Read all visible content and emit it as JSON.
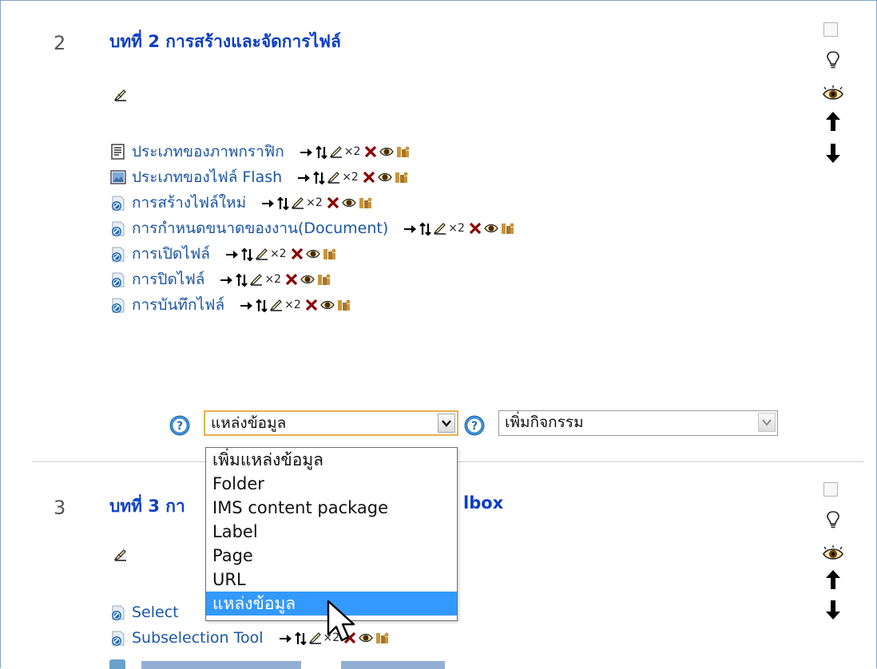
{
  "sections": [
    {
      "number": "2",
      "title": "บทที่ 2 การสร้างและจัดการไฟล์",
      "activities": [
        {
          "icon": "document-icon",
          "label": "ประเภทของภาพกราฟิก"
        },
        {
          "icon": "image-file-icon",
          "label": "ประเภทของไฟล์ Flash"
        },
        {
          "icon": "url-link-icon",
          "label": "การสร้างไฟล์ใหม่"
        },
        {
          "icon": "url-link-icon",
          "label": "การกำหนดขนาดของงาน(Document)"
        },
        {
          "icon": "url-link-icon",
          "label": "การเปิดไฟล์"
        },
        {
          "icon": "url-link-icon",
          "label": "การปิดไฟล์"
        },
        {
          "icon": "url-link-icon",
          "label": "การบันทึกไฟล์"
        }
      ]
    },
    {
      "number": "3",
      "title_visible_start": "บทที่ 3 กา",
      "title_visible_end": "lbox",
      "activities": [
        {
          "icon": "url-link-icon",
          "label": "Select"
        },
        {
          "icon": "url-link-icon",
          "label": "Subselection Tool"
        }
      ]
    }
  ],
  "edit_controls": {
    "duplicate_indicator": "×2"
  },
  "add_resource": {
    "selected": "แหล่งข้อมูล",
    "options": [
      "เพิ่มแหล่งข้อมูล",
      "Folder",
      "IMS content package",
      "Label",
      "Page",
      "URL",
      "แหล่งข้อมูล"
    ],
    "highlighted_index": 6
  },
  "add_activity": {
    "selected": "เพิ่มกิจกรรม"
  },
  "colors": {
    "section_title": "#0b3ec9",
    "activity_link": "#1a56a6",
    "dropdown_highlight": "#3399ff",
    "select_focus_border": "#e8b050"
  }
}
